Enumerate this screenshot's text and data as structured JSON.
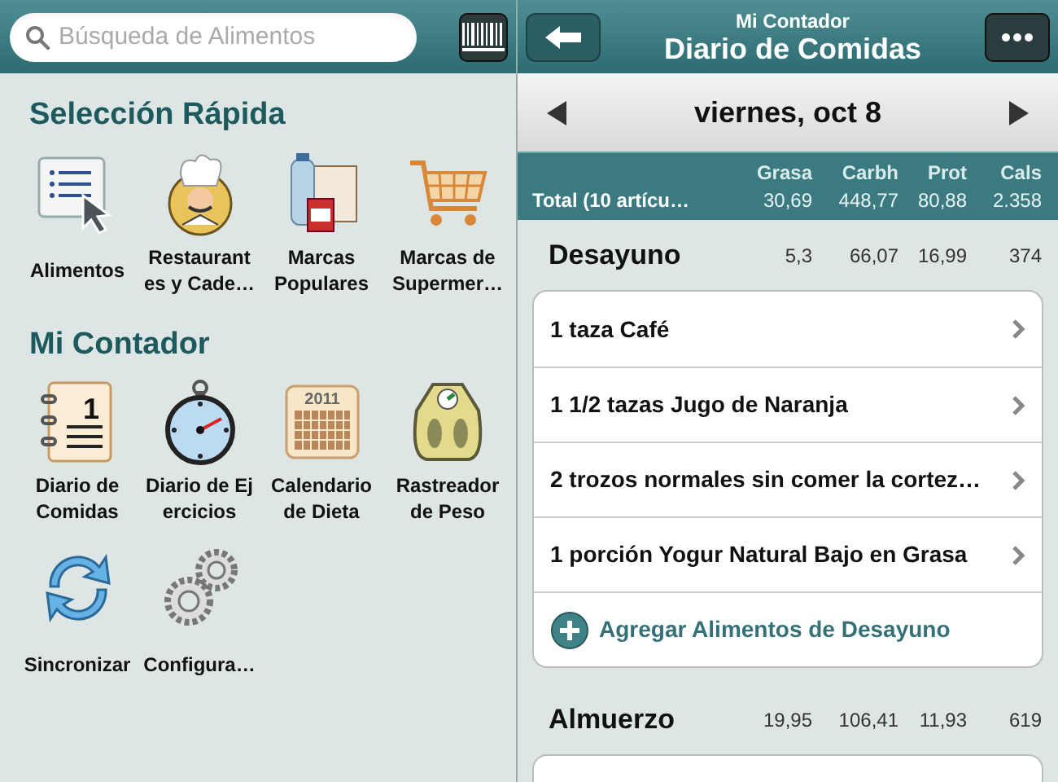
{
  "search": {
    "placeholder": "Búsqueda de Alimentos"
  },
  "sections": [
    {
      "title": "Selección Rápida",
      "items": [
        {
          "label": "Alimentos"
        },
        {
          "label": "Restaurant es y Cade…"
        },
        {
          "label": "Marcas Populares"
        },
        {
          "label": "Marcas de Supermer…"
        }
      ]
    },
    {
      "title": "Mi Contador",
      "items": [
        {
          "label": "Diario de Comidas"
        },
        {
          "label": "Diario de Ej ercicios"
        },
        {
          "label": "Calendario de Dieta"
        },
        {
          "label": "Rastreador de Peso"
        },
        {
          "label": "Sincronizar"
        },
        {
          "label": "Configura…"
        }
      ]
    }
  ],
  "calendar_year": "2011",
  "diary_icon_number": "1",
  "nav": {
    "subtitle": "Mi Contador",
    "title": "Diario de Comidas"
  },
  "date": "viernes, oct 8",
  "totals": {
    "columns": [
      "Grasa",
      "Carbh",
      "Prot",
      "Cals"
    ],
    "label": "Total (10 artícu…",
    "values": [
      "30,69",
      "448,77",
      "80,88",
      "2.358"
    ]
  },
  "meals": [
    {
      "name": "Desayuno",
      "values": [
        "5,3",
        "66,07",
        "16,99",
        "374"
      ],
      "items": [
        "1 taza Café",
        "1 1/2 tazas Jugo de Naranja",
        "2 trozos normales sin comer la cortez…",
        "1 porción Yogur Natural Bajo en Grasa"
      ],
      "add_label": "Agregar Alimentos de Desayuno"
    },
    {
      "name": "Almuerzo",
      "values": [
        "19,95",
        "106,41",
        "11,93",
        "619"
      ]
    }
  ]
}
